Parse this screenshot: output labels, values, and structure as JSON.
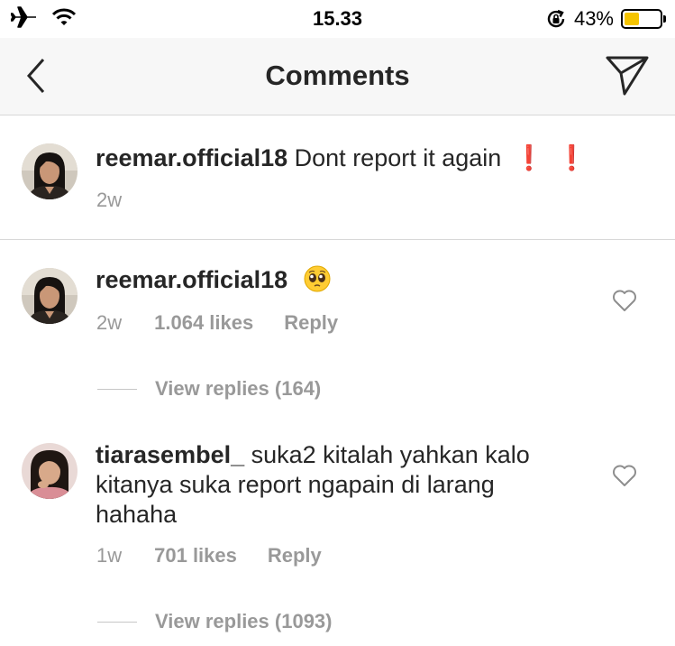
{
  "status_bar": {
    "time": "15.33",
    "battery_percent": "43%",
    "battery_level": 0.43,
    "icons": [
      "airplane-icon",
      "wifi-icon",
      "orientation-lock-icon",
      "battery-icon"
    ]
  },
  "header": {
    "title": "Comments",
    "back_icon": "chevron-left-icon",
    "share_icon": "send-icon"
  },
  "caption": {
    "username": "reemar.official18",
    "text": "Dont report it again",
    "emphasis": "❗",
    "time": "2w"
  },
  "comments": [
    {
      "username": "reemar.official18",
      "text": "",
      "emoji": "pleading-face-emoji",
      "time": "2w",
      "likes": "1.064 likes",
      "reply_label": "Reply",
      "view_replies": "View replies (164)"
    },
    {
      "username": "tiarasembel_",
      "text": "suka2 kitalah yahkan kalo kitanya suka report ngapain di larang hahaha",
      "time": "1w",
      "likes": "701 likes",
      "reply_label": "Reply",
      "view_replies": "View replies (1093)"
    }
  ],
  "colors": {
    "nav_bg": "#f7f7f7",
    "secondary_text": "#999999",
    "divider": "#d8d8d8",
    "battery": "#f5c400",
    "emphasis": "#e0001a"
  }
}
